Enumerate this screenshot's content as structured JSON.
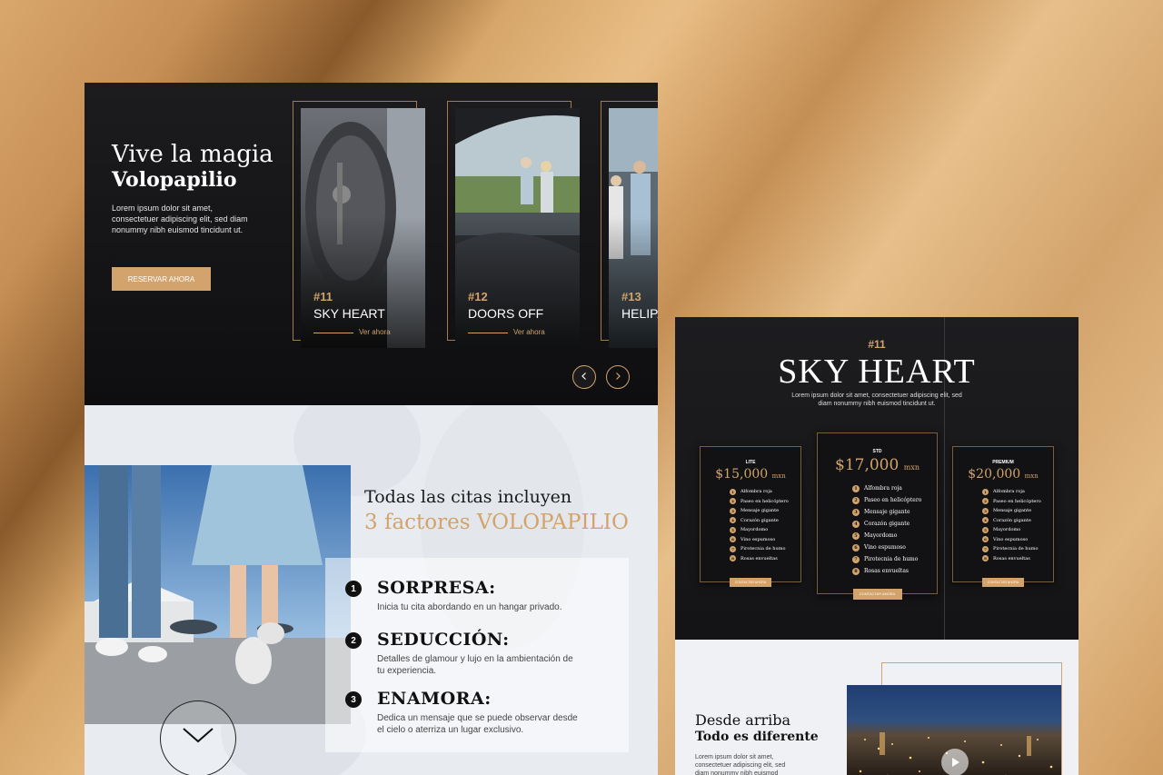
{
  "left": {
    "hero": {
      "title_line1": "Vive la magia",
      "title_line2": "Volopapilio",
      "description": "Lorem ipsum dolor sit amet, consectetuer adipiscing elit, sed diam nonummy nibh euismod tincidunt ut.",
      "cta_label": "RESERVAR AHORA"
    },
    "cards": [
      {
        "number": "#11",
        "name": "SKY HEART",
        "link": "Ver ahora"
      },
      {
        "number": "#12",
        "name": "DOORS OFF",
        "link": "Ver ahora"
      },
      {
        "number": "#13",
        "name": "HELIPA",
        "link": ""
      }
    ],
    "features": {
      "title_line1": "Todas las citas incluyen",
      "title_line2": "3 factores VOLOPAPILIO",
      "items": [
        {
          "badge": "1",
          "title": "SORPRESA:",
          "desc": "Inicia tu cita abordando en un hangar privado."
        },
        {
          "badge": "2",
          "title": "SEDUCCIÓN:",
          "desc": "Detalles de glamour y lujo en la ambientación de tu experiencia."
        },
        {
          "badge": "3",
          "title": "ENAMORA:",
          "desc": "Dedica un mensaje que se puede observar desde el cielo o aterriza un lugar exclusivo."
        }
      ]
    }
  },
  "right": {
    "number": "#11",
    "title": "SKY HEART",
    "description": "Lorem ipsum dolor sit amet, consectetuer adipiscing elit, sed diam nonummy nibh euismod tincidunt ut.",
    "plans": [
      {
        "tier": "LITE",
        "price": "$15,000",
        "currency": "mxn",
        "features": [
          "Alfombra roja",
          "Paseo en helicóptero",
          "Mensaje gigante",
          "Corazón gigante",
          "Mayordomo",
          "Vino espumoso",
          "Pirotecnia de humo",
          "Rosas envueltas"
        ],
        "badges": [
          "1",
          "2",
          "3",
          "4",
          "5",
          "6",
          "7",
          "8"
        ],
        "cta": "CONTACTAR AHORA"
      },
      {
        "tier": "STD",
        "price": "$17,000",
        "currency": "mxn",
        "features": [
          "Alfombra roja",
          "Paseo en helicóptero",
          "Mensaje gigante",
          "Corazón gigante",
          "Mayordomo",
          "Vino espumoso",
          "Pirotecnia de humo",
          "Rosas envueltas"
        ],
        "badges": [
          "1",
          "2",
          "3",
          "4",
          "5",
          "6",
          "7",
          "8"
        ],
        "cta": "CONTACTAR AHORA"
      },
      {
        "tier": "PREMIUM",
        "price": "$20,000",
        "currency": "mxn",
        "features": [
          "Alfombra roja",
          "Paseo en helicóptero",
          "Mensaje gigante",
          "Corazón gigante",
          "Mayordomo",
          "Vino espumoso",
          "Pirotecnia de humo",
          "Rosas envueltas"
        ],
        "badges": [
          "1",
          "2",
          "3",
          "4",
          "5",
          "6",
          "7",
          "8"
        ],
        "cta": "CONTACTAR AHORA"
      }
    ],
    "bottom": {
      "title_line1": "Desde arriba",
      "title_line2": "Todo es diferente",
      "description": "Lorem ipsum dolor sit amet, consectetuer adipiscing elit, sed diam nonummy nibh euismod"
    }
  },
  "icons": {
    "prev": "chevron-left-icon",
    "next": "chevron-right-icon",
    "scroll": "chevron-down-icon",
    "play": "play-icon"
  },
  "colors": {
    "gold": "#d2a36b",
    "dark": "#141416",
    "light": "#eef1f5"
  }
}
